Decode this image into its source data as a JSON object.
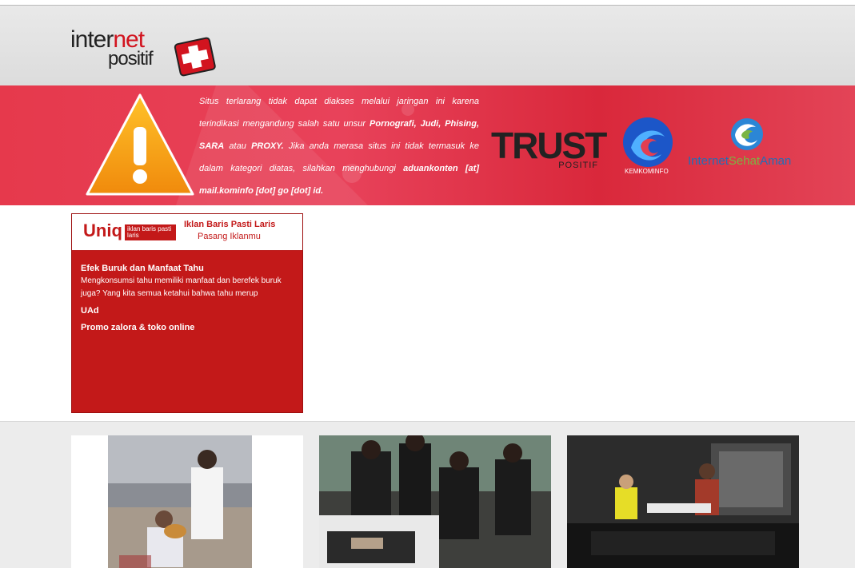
{
  "header": {
    "logo_word1": "inter",
    "logo_word1_red": "net",
    "logo_word2": "positif"
  },
  "banner": {
    "message_plain1": "Situs terlarang tidak dapat diakses melalui jaringan ini karena terindikasi mengandung salah satu unsur ",
    "keyword1": "Pornografi, Judi, Phising, SARA",
    "message_plain2": " atau ",
    "keyword2": "PROXY.",
    "message_plain3": " Jika anda merasa situs ini tidak termasuk ke dalam kategori diatas, silahkan menghubungi ",
    "contact": "aduankonten [at] mail.kominfo [dot] go [dot] id.",
    "trust_word": "TRUST",
    "trust_sub": "POSITIF",
    "kominfo_label": "KEMKOMINFO",
    "isa_part1": "Internet",
    "isa_part2": "Sehat",
    "isa_part3": "Aman"
  },
  "ad": {
    "brand": "Uniq",
    "brand_tag": "iklan baris pasti laris",
    "headline": "Iklan Baris Pasti Laris",
    "cta": "Pasang Iklanmu",
    "items": [
      {
        "title": "Efek Buruk dan Manfaat Tahu",
        "text": "Mengkonsumsi tahu memiliki manfaat dan berefek buruk juga? Yang kita semua ketahui bahwa tahu merup"
      },
      {
        "title": "UAd",
        "text": ""
      },
      {
        "title": "Promo zalora & toko online",
        "text": ""
      }
    ]
  },
  "colors": {
    "banner_red": "#e23f52",
    "ad_red": "#c31919",
    "brand_red": "#d2141f",
    "isa_blue": "#1e6fb8",
    "isa_green": "#7ab542"
  },
  "thumbnails": [
    "proposal-photo",
    "funeral-photo",
    "concert-photo"
  ]
}
